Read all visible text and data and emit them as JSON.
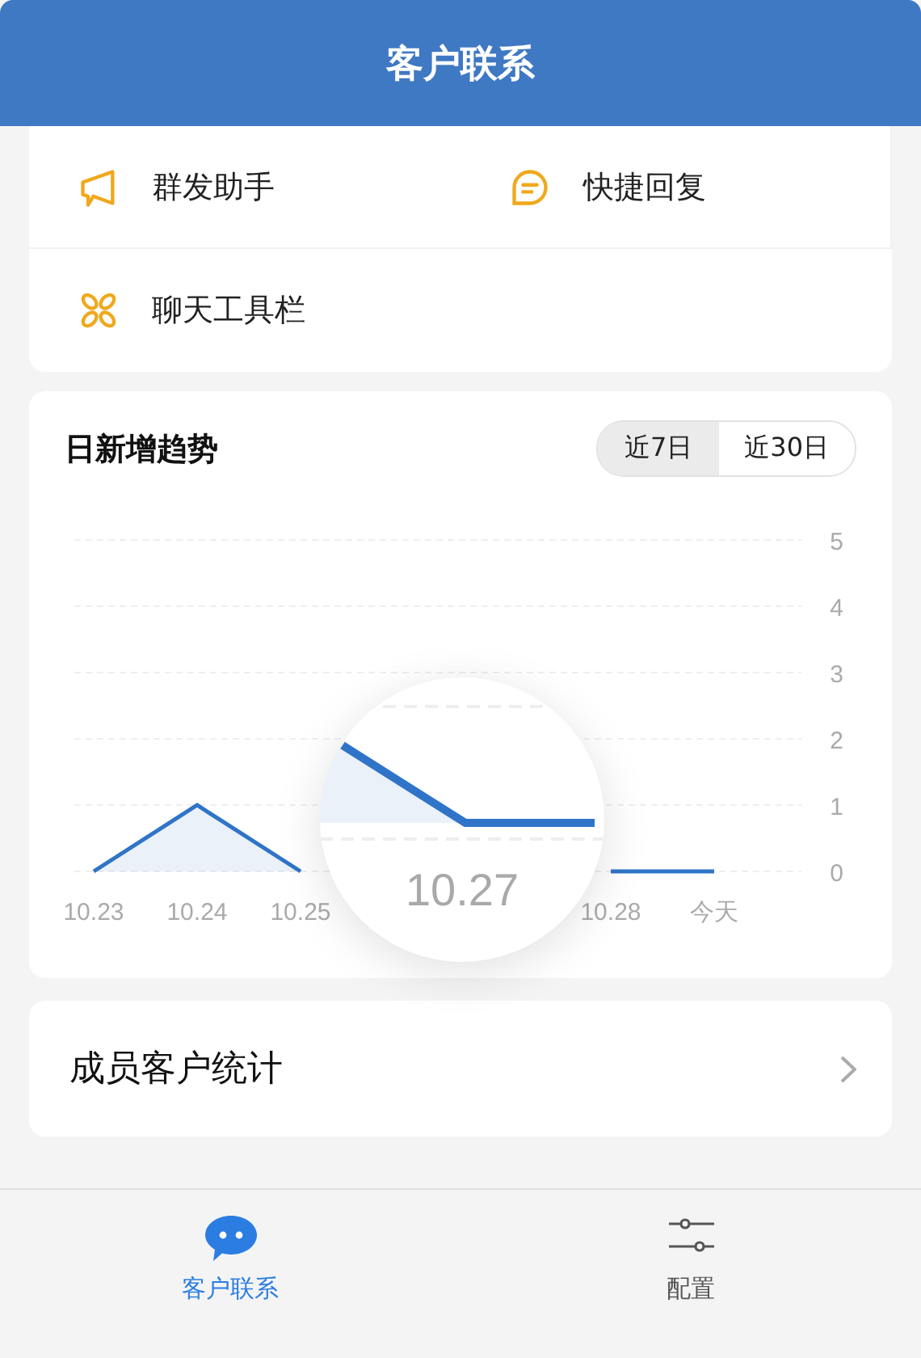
{
  "header": {
    "title": "客户联系"
  },
  "shortcuts": [
    {
      "kind": "megaphone",
      "label": "群发助手"
    },
    {
      "kind": "chat",
      "label": "快捷回复"
    },
    {
      "kind": "grid",
      "label": "聊天工具栏"
    }
  ],
  "trend": {
    "title": "日新增趋势",
    "ranges": [
      {
        "label": "近7日",
        "selected": true
      },
      {
        "label": "近30日",
        "selected": false
      }
    ],
    "chart_data": {
      "type": "line",
      "categories": [
        "10.23",
        "10.24",
        "10.25",
        null,
        null,
        "10.28",
        "今天"
      ],
      "series": [
        {
          "color": "#2f74c8",
          "values": [
            0,
            1,
            0,
            null,
            null,
            0,
            0
          ]
        }
      ],
      "ylim": [
        0,
        5
      ],
      "yticks": [
        0,
        1,
        2,
        3,
        4,
        5
      ],
      "grid": true
    },
    "magnifier": {
      "label": "10.27"
    }
  },
  "member_stats": {
    "label": "成员客户统计"
  },
  "tabs": [
    {
      "kind": "chat",
      "label": "客户联系",
      "selected": true
    },
    {
      "kind": "sliders",
      "label": "配置",
      "selected": false
    }
  ]
}
